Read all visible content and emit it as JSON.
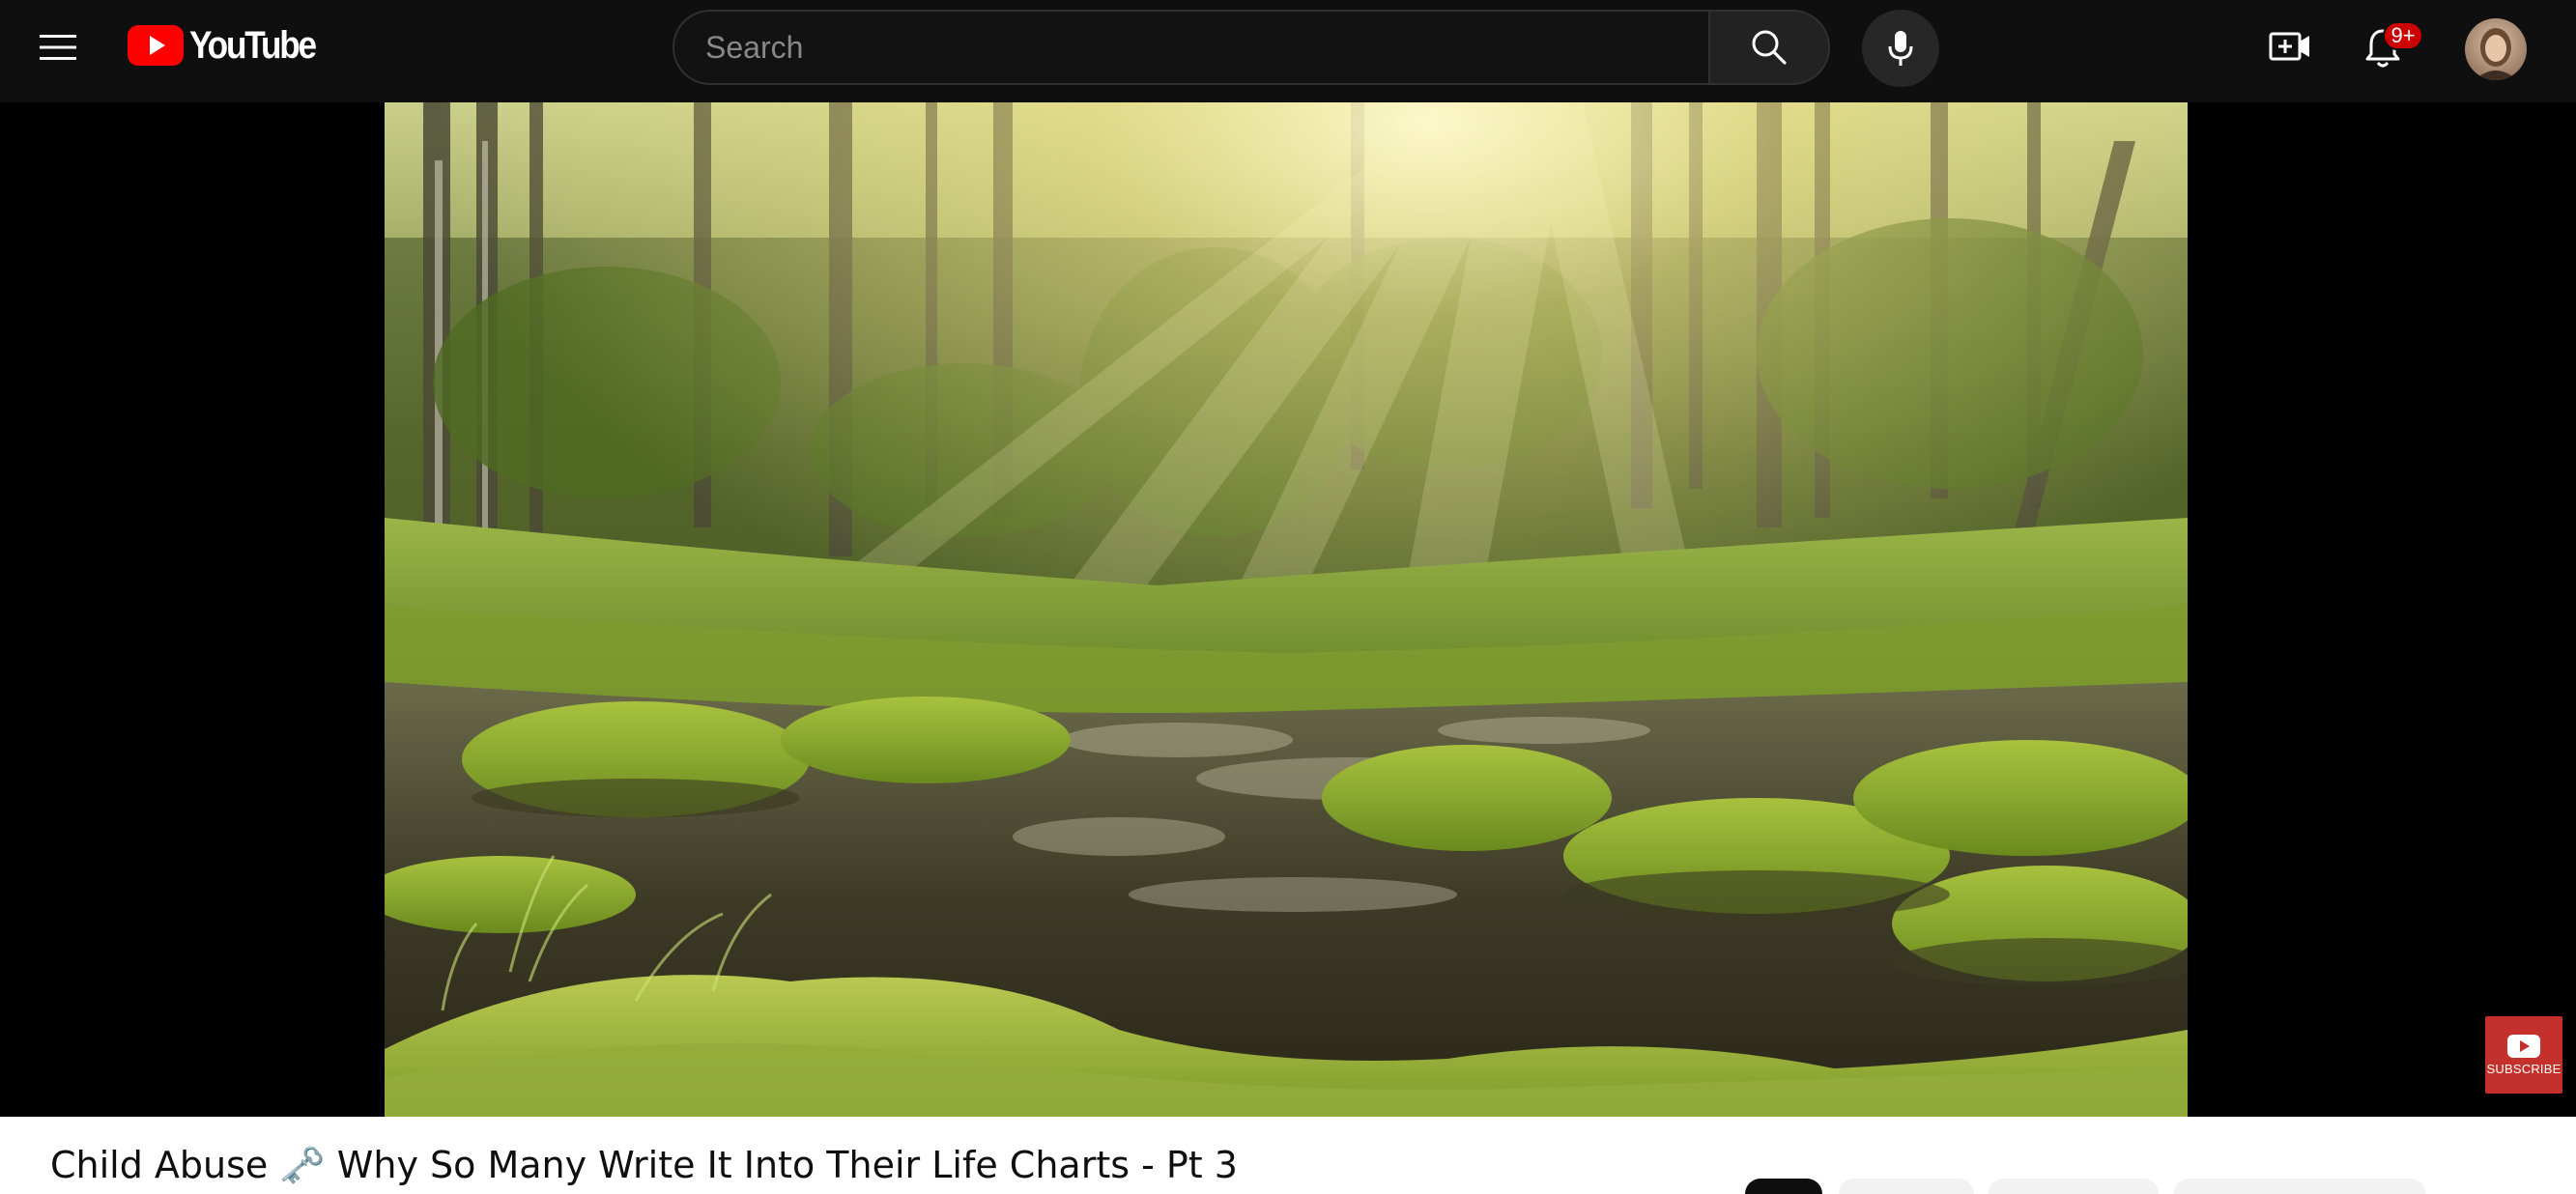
{
  "header": {
    "logo_text": "YouTube",
    "search_placeholder": "Search",
    "notification_count": "9+",
    "icons": {
      "menu": "hamburger-menu-icon",
      "search": "search-icon",
      "mic": "microphone-icon",
      "create": "create-video-icon",
      "notifications": "bell-icon"
    }
  },
  "player": {
    "watermark_label": "SUBSCRIBE"
  },
  "video": {
    "title": "Child Abuse 🗝️ Why So Many Write It Into Their Life Charts - Pt 3"
  },
  "colors": {
    "brand_red": "#ff0000",
    "badge_red": "#cc0000",
    "topbar_bg": "#0f0f0f"
  }
}
